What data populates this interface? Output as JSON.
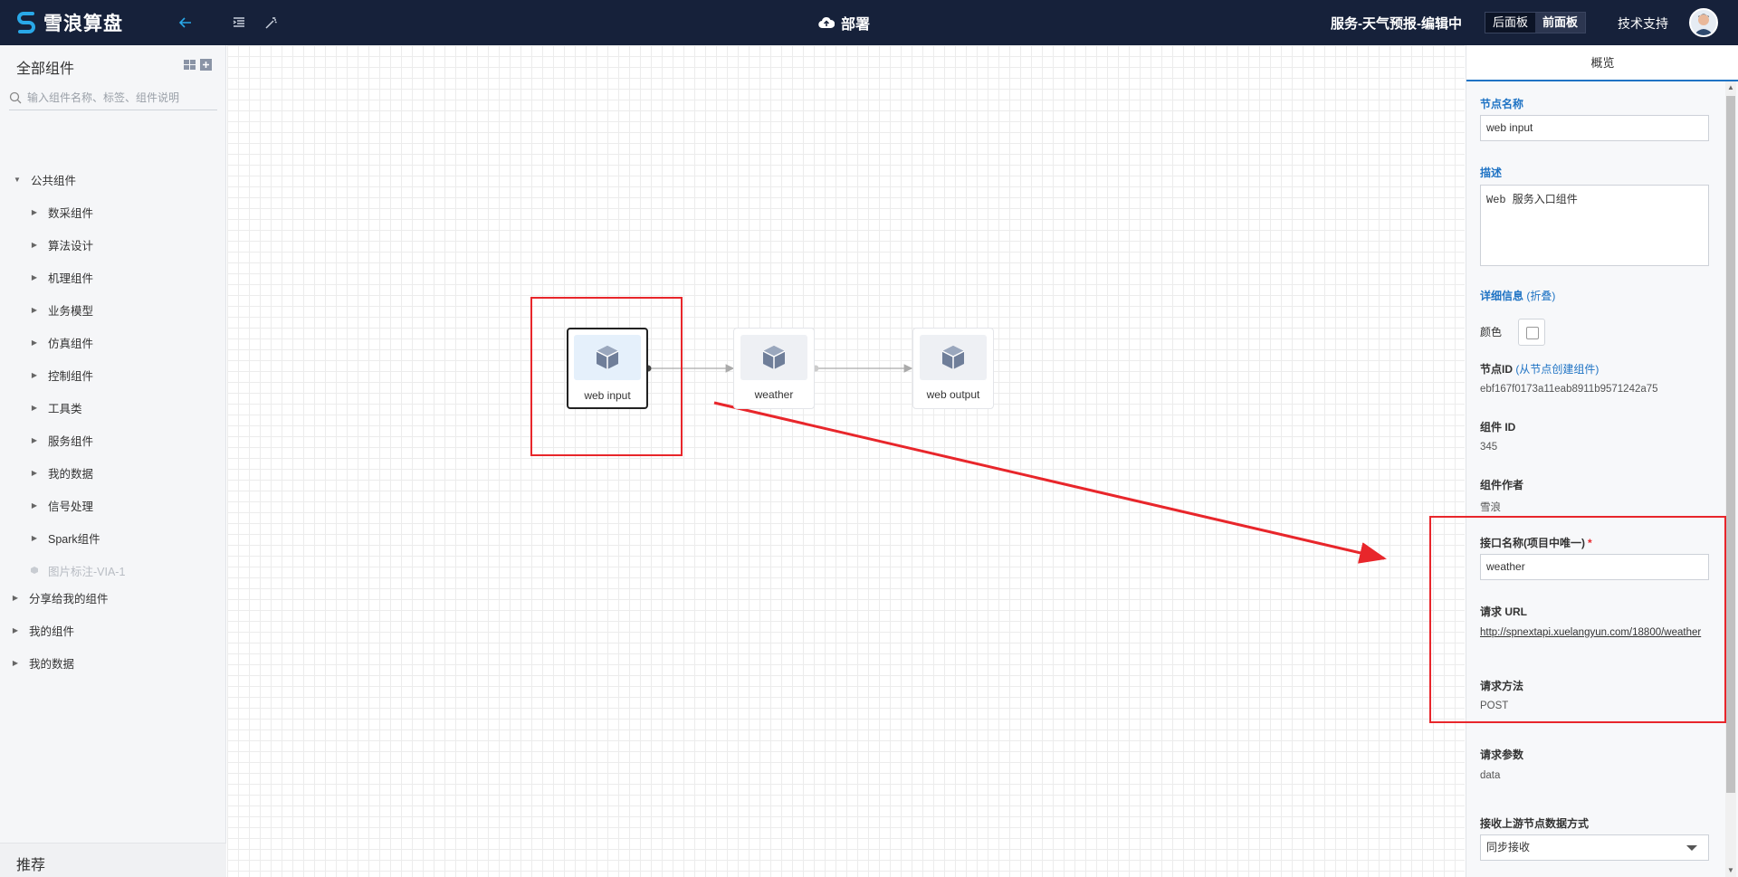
{
  "app": {
    "brand": "雪浪算盘"
  },
  "topbar": {
    "deploy_label": "部署",
    "service_title": "服务-天气预报-编辑中",
    "back_panel": "后面板",
    "front_panel": "前面板",
    "support": "技术支持"
  },
  "sidebar": {
    "title": "全部组件",
    "search_placeholder": "输入组件名称、标签、组件说明",
    "public_group": "公共组件",
    "public_items": [
      "数采组件",
      "算法设计",
      "机理组件",
      "业务模型",
      "仿真组件",
      "控制组件",
      "工具类",
      "服务组件",
      "我的数据",
      "信号处理",
      "Spark组件"
    ],
    "disabled_item": "图片标注-VIA-1",
    "groups": [
      "分享给我的组件",
      "我的组件",
      "我的数据"
    ],
    "recommend": "推荐"
  },
  "canvas": {
    "nodes": [
      {
        "label": "web input"
      },
      {
        "label": "weather"
      },
      {
        "label": "web output"
      }
    ]
  },
  "panel": {
    "tab": "概览",
    "node_name_label": "节点名称",
    "node_name_value": "web input",
    "desc_label": "描述",
    "desc_value": "Web 服务入口组件",
    "detail_label": "详细信息",
    "detail_toggle": "(折叠)",
    "color_label": "颜色",
    "node_id_label": "节点ID",
    "node_id_sub": "(从节点创建组件)",
    "node_id_value": "ebf167f0173a11eab8911b9571242a75",
    "component_id_label": "组件 ID",
    "component_id_value": "345",
    "author_label": "组件作者",
    "author_value": "雪浪",
    "api_name_label": "接口名称(项目中唯一)",
    "api_name_required": "*",
    "api_name_value": "weather",
    "url_label": "请求 URL",
    "url_value": "http://spnextapi.xuelangyun.com/18800/weather",
    "method_label": "请求方法",
    "method_value": "POST",
    "params_label": "请求参数",
    "params_value": "data",
    "receive_label": "接收上游节点数据方式",
    "receive_value": "同步接收"
  },
  "colors": {
    "topbar": "#16213a",
    "accent": "#1f73c4",
    "annotation": "#e8262b"
  }
}
